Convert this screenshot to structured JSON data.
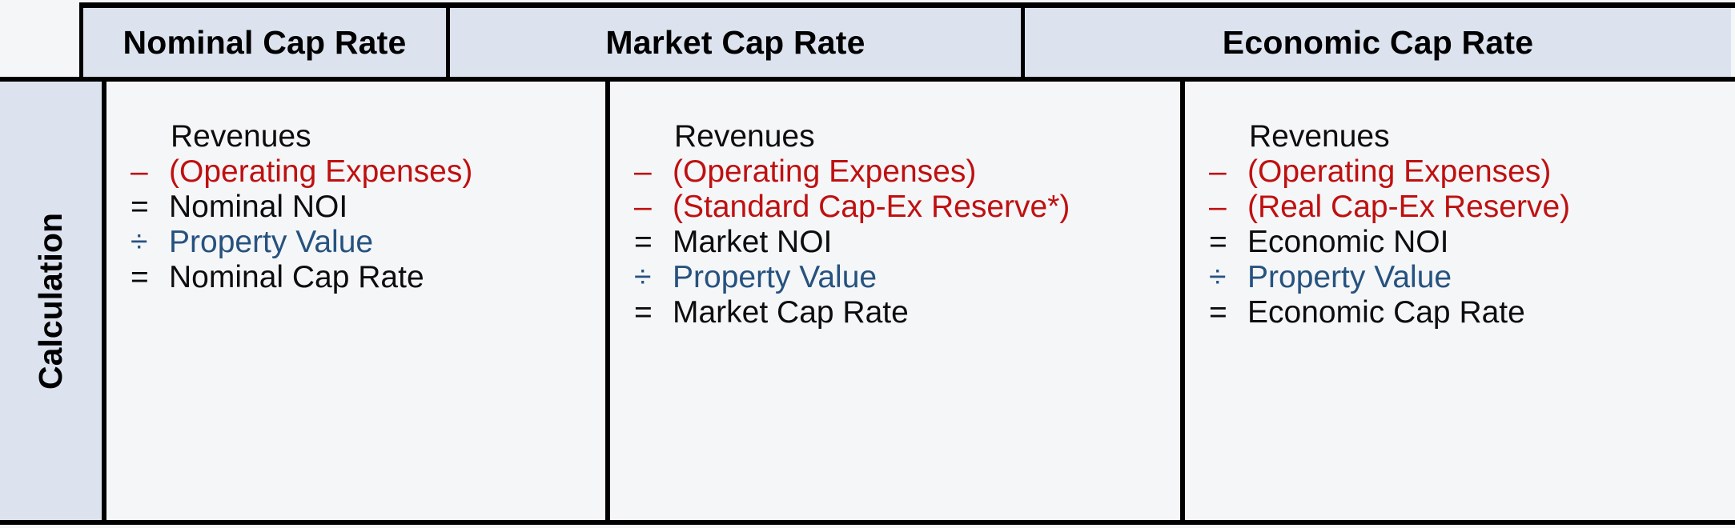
{
  "table": {
    "row_label": "Calculation",
    "corner_cell": "",
    "columns": [
      {
        "header": "Nominal Cap Rate",
        "lines": [
          {
            "op": "",
            "text": "Revenues",
            "color": "black"
          },
          {
            "op": "–",
            "text": "(Operating Expenses)",
            "color": "red"
          },
          {
            "op": "=",
            "text": "Nominal NOI",
            "color": "black"
          },
          {
            "op": "÷",
            "text": "Property Value",
            "color": "blue"
          },
          {
            "op": "=",
            "text": "Nominal Cap Rate",
            "color": "black"
          }
        ]
      },
      {
        "header": "Market Cap Rate",
        "lines": [
          {
            "op": "",
            "text": "Revenues",
            "color": "black"
          },
          {
            "op": "–",
            "text": "(Operating Expenses)",
            "color": "red"
          },
          {
            "op": "–",
            "text": "(Standard Cap-Ex Reserve*)",
            "color": "red"
          },
          {
            "op": "=",
            "text": "Market NOI",
            "color": "black"
          },
          {
            "op": "÷",
            "text": "Property Value",
            "color": "blue"
          },
          {
            "op": "=",
            "text": "Market Cap Rate",
            "color": "black"
          }
        ]
      },
      {
        "header": "Economic Cap Rate",
        "lines": [
          {
            "op": "",
            "text": "Revenues",
            "color": "black"
          },
          {
            "op": "–",
            "text": "(Operating Expenses)",
            "color": "red"
          },
          {
            "op": "–",
            "text": "(Real Cap-Ex Reserve)",
            "color": "red"
          },
          {
            "op": "=",
            "text": "Economic NOI",
            "color": "black"
          },
          {
            "op": "÷",
            "text": "Property Value",
            "color": "blue"
          },
          {
            "op": "=",
            "text": "Economic Cap Rate",
            "color": "black"
          }
        ]
      }
    ]
  },
  "colors": {
    "header_fill": "#dce3ef",
    "cell_fill": "#f5f6f8",
    "border": "#000000",
    "text_black": "#0d0d0d",
    "text_red": "#bf1010",
    "text_blue": "#26527f"
  }
}
